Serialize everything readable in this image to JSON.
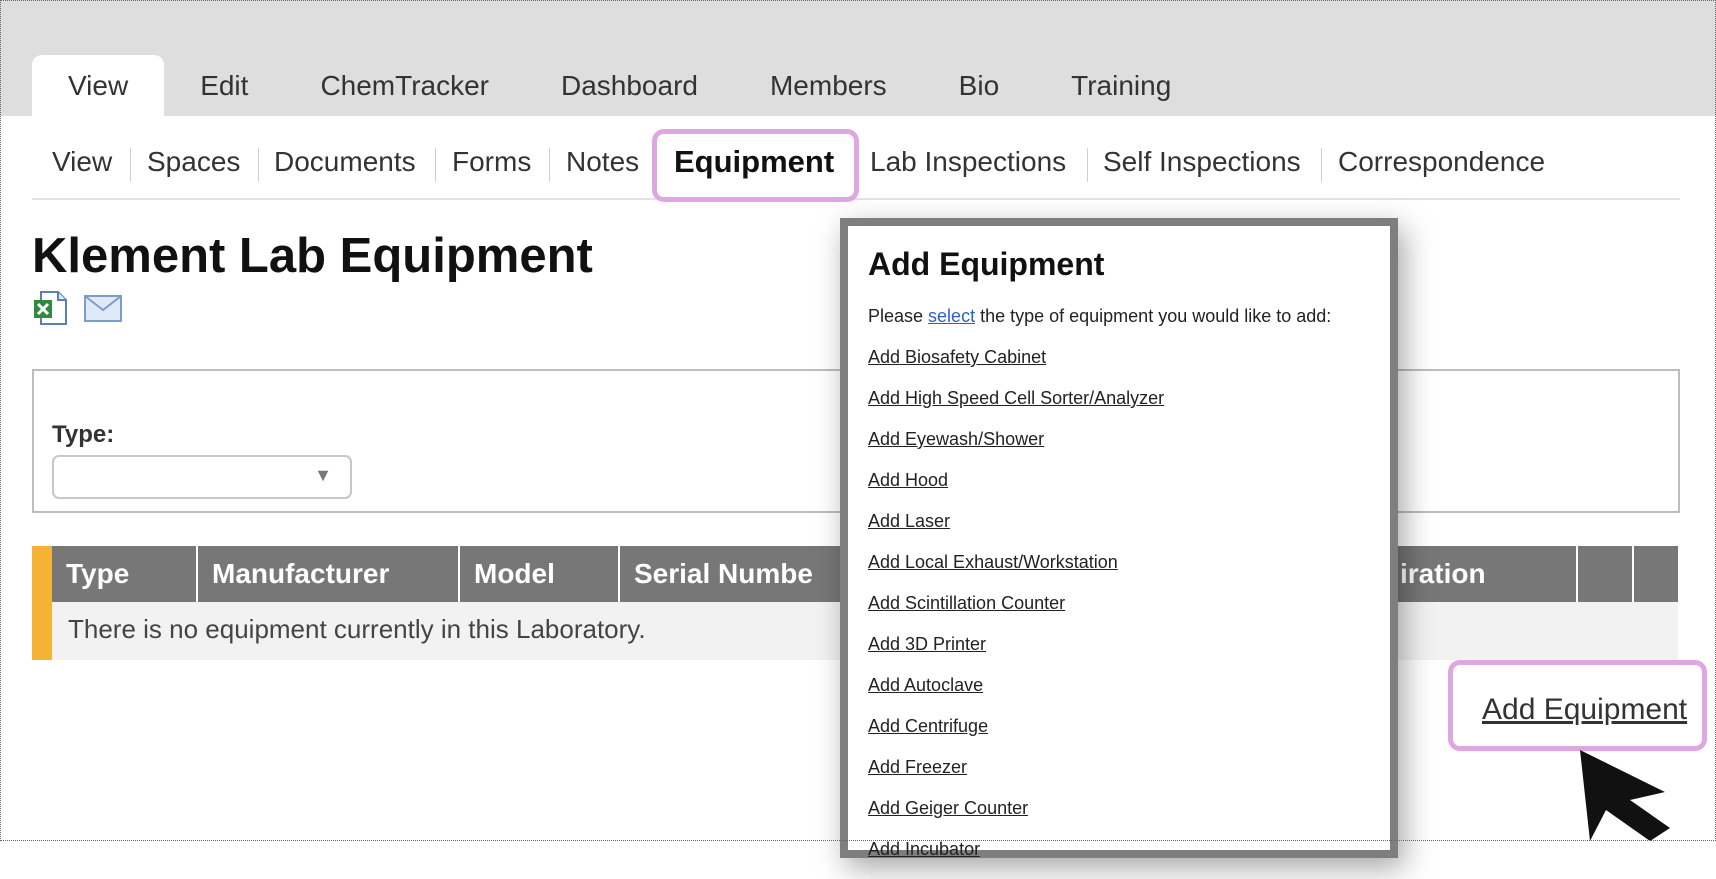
{
  "top_tabs": [
    "View",
    "Edit",
    "ChemTracker",
    "Dashboard",
    "Members",
    "Bio",
    "Training"
  ],
  "sub_nav": [
    "View",
    "Spaces",
    "Documents",
    "Forms",
    "Notes",
    "Equipment",
    "Lab Inspections",
    "Self Inspections",
    "Correspondence"
  ],
  "page_title": "Klement Lab Equipment",
  "filter": {
    "type_label": "Type:",
    "type_value": ""
  },
  "table": {
    "headers": [
      "Type",
      "Manufacturer",
      "Model",
      "Serial Number",
      "Expiration",
      "",
      ""
    ],
    "visible_headers": [
      "Type",
      "Manufacturer",
      "Model",
      "Serial Numbe",
      "iration"
    ],
    "empty_message": "There is no equipment currently in this Laboratory."
  },
  "add_equipment_link": "Add Equipment",
  "modal": {
    "title": "Add Equipment",
    "intro_before": "Please ",
    "intro_link": "select",
    "intro_after": " the type of equipment you would like to add:",
    "options": [
      "Add Biosafety Cabinet",
      "Add High Speed Cell Sorter/Analyzer",
      "Add Eyewash/Shower",
      "Add Hood",
      "Add Laser",
      "Add Local Exhaust/Workstation",
      "Add Scintillation Counter",
      "Add 3D Printer",
      "Add Autoclave",
      "Add Centrifuge",
      "Add Freezer",
      "Add Geiger Counter",
      "Add Incubator"
    ]
  },
  "colors": {
    "highlight": "#dfa7e2",
    "table_header": "#777777",
    "row_accent": "#f5b335",
    "link_blue": "#2a62c9"
  }
}
